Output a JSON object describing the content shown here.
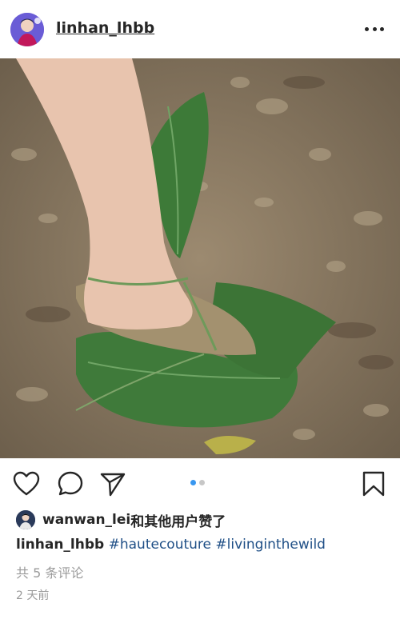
{
  "post": {
    "username": "linhan_lhbb"
  },
  "photo": {
    "alt": "",
    "carousel_total": 2,
    "carousel_current": 1
  },
  "colors": {
    "text": "#262626",
    "hashtag": "#1f4f86",
    "muted": "#9a9a9a",
    "dot_active": "#3897f0",
    "dot_inactive": "#c7c7c7"
  },
  "icons": {
    "like": "heart-icon",
    "comment": "comment-icon",
    "share": "paper-plane-icon",
    "save": "bookmark-icon",
    "more": "more-dots-icon"
  },
  "likes": {
    "user": "wanwan_lei",
    "suffix": "和其他用户赞了"
  },
  "caption": {
    "username": "linhan_lhbb",
    "hashtags": [
      "#hautecouture",
      "#livinginthewild"
    ]
  },
  "comments_link": "共 5 条评论",
  "timestamp": "2 天前"
}
